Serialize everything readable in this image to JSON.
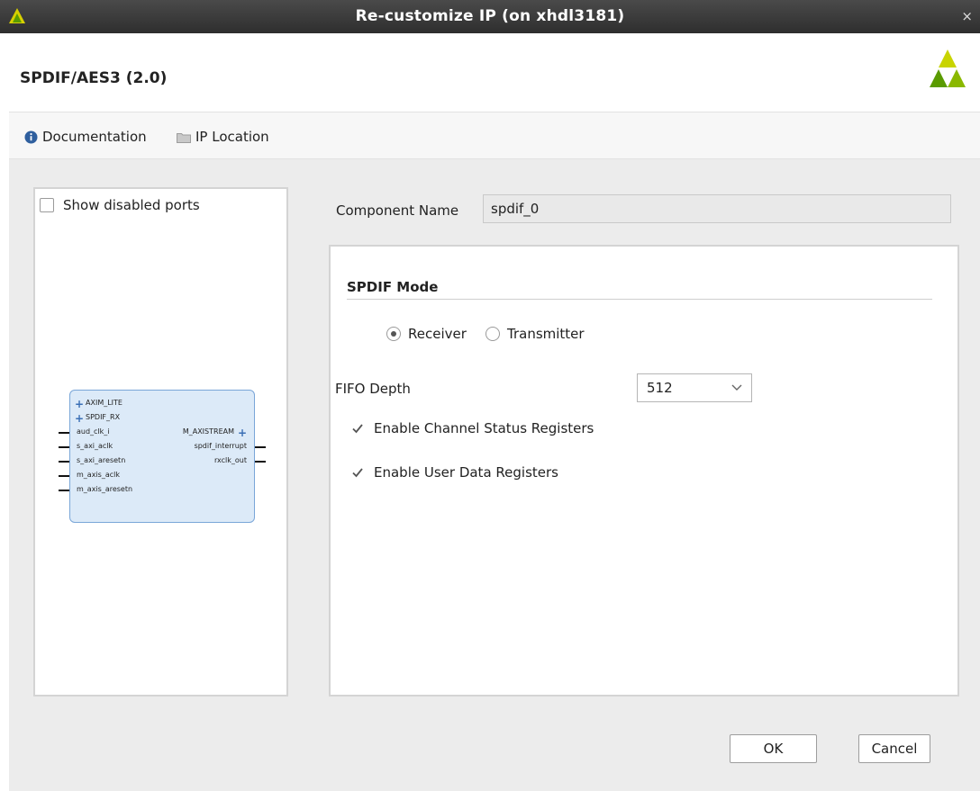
{
  "window": {
    "title": "Re-customize IP (on xhdl3181)",
    "close_glyph": "×"
  },
  "header": {
    "ip_name": "SPDIF/AES3 (2.0)",
    "logo_icon": "xilinx-logo"
  },
  "toolbar": {
    "documentation_label": "Documentation",
    "ip_location_label": "IP Location"
  },
  "left_panel": {
    "show_disabled_ports_label": "Show disabled ports",
    "show_disabled_ports_checked": false,
    "symbol": {
      "left_ports": [
        "AXIM_LITE",
        "SPDIF_RX",
        "aud_clk_i",
        "s_axi_aclk",
        "s_axi_aresetn",
        "m_axis_aclk",
        "m_axis_aresetn"
      ],
      "right_ports": [
        "M_AXISTREAM",
        "spdif_interrupt",
        "rxclk_out"
      ]
    }
  },
  "component": {
    "label": "Component Name",
    "value": "spdif_0"
  },
  "spdif": {
    "section_title": "SPDIF Mode",
    "mode_options": [
      "Receiver",
      "Transmitter"
    ],
    "mode_selected": "Receiver",
    "fifo_depth_label": "FIFO Depth",
    "fifo_depth_value": "512",
    "enable_channel_status_label": "Enable Channel Status Registers",
    "enable_channel_status_checked": true,
    "enable_user_data_label": "Enable User Data Registers",
    "enable_user_data_checked": true
  },
  "buttons": {
    "ok": "OK",
    "cancel": "Cancel"
  },
  "colors": {
    "titlebar": "#3a3a3a",
    "logo_yellow": "#c8d400",
    "logo_green": "#5a9b00",
    "symbol_fill": "#dceaf8",
    "symbol_border": "#7aa6d8"
  }
}
